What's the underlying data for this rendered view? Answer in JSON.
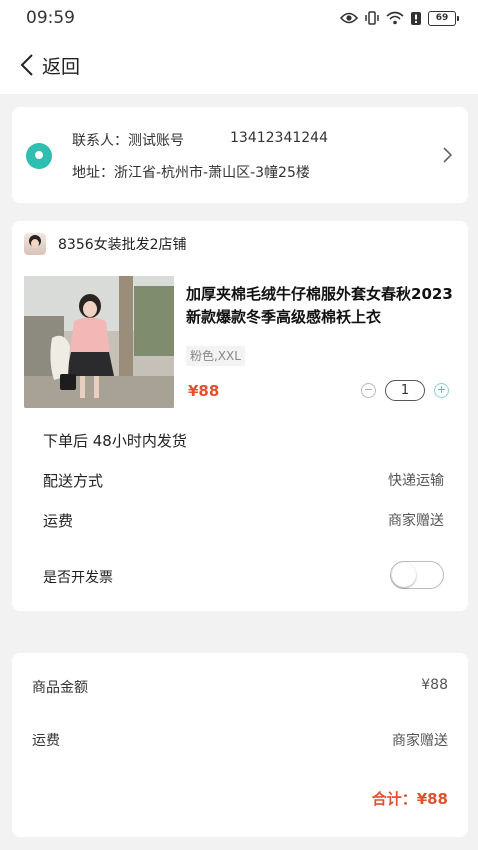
{
  "status_bar": {
    "time": "09:59",
    "battery": "69"
  },
  "nav": {
    "back_label": "返回"
  },
  "address": {
    "contact": "联系人：测试账号",
    "phone": "13412341244",
    "address": "地址：浙江省-杭州市-萧山区-3幢25楼"
  },
  "shop": {
    "name": "8356女装批发2店铺"
  },
  "product": {
    "title": "加厚夹棉毛绒牛仔棉服外套女春秋2023新款爆款冬季高级感棉袄上衣",
    "spec": "粉色,XXL",
    "price": "¥88",
    "quantity": "1"
  },
  "shipping_note": "下单后 48小时内发货",
  "delivery": {
    "label": "配送方式",
    "value": "快递运输"
  },
  "freight": {
    "label": "运费",
    "value": "商家赠送"
  },
  "invoice": {
    "label": "是否开发票",
    "enabled": false
  },
  "summary": {
    "goods_label": "商品金额",
    "goods_value": "¥88",
    "freight_label": "运费",
    "freight_value": "商家赠送",
    "total": "合计：¥88"
  },
  "colors": {
    "accent": "#2ebfb0",
    "price": "#e0522f"
  }
}
